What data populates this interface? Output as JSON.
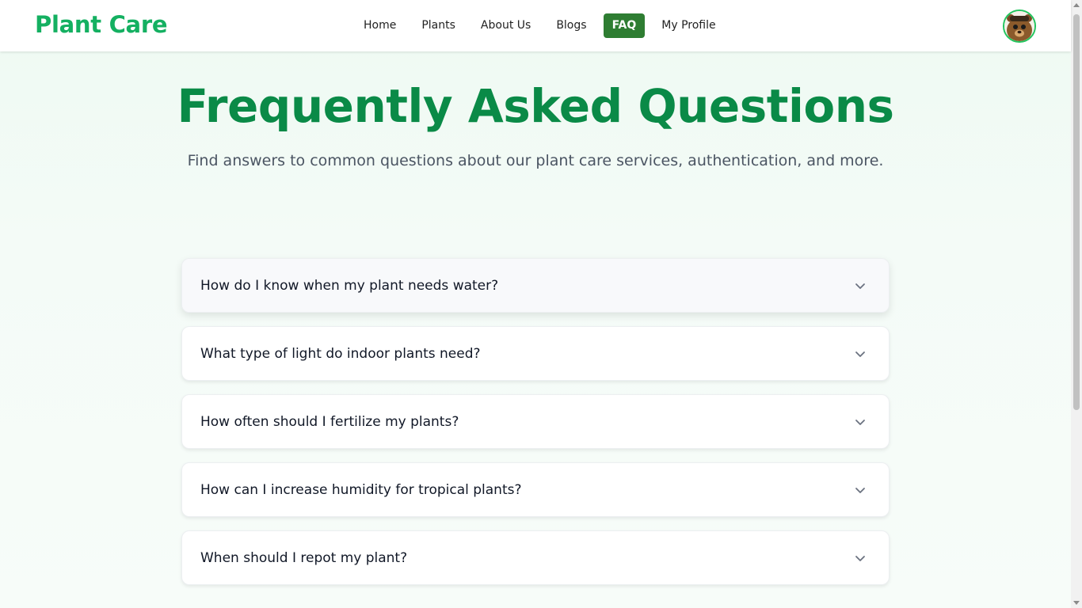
{
  "brand": {
    "name": "Plant Care",
    "color": "#14b061"
  },
  "nav": {
    "links": [
      {
        "label": "Home"
      },
      {
        "label": "Plants"
      },
      {
        "label": "About Us"
      },
      {
        "label": "Blogs"
      },
      {
        "label": "FAQ",
        "active": true
      },
      {
        "label": "My Profile"
      }
    ],
    "active_color": "#2e7d32"
  },
  "user": {
    "avatar_icon": "bear-avatar-icon"
  },
  "hero": {
    "title": "Frequently Asked Questions",
    "subtitle": "Find answers to common questions about our plant care services, authentication, and more.",
    "title_color": "#0a8a47"
  },
  "faq": {
    "items": [
      {
        "question": "How do I know when my plant needs water?",
        "icon": "chevron-down-icon"
      },
      {
        "question": "What type of light do indoor plants need?",
        "icon": "chevron-down-icon"
      },
      {
        "question": "How often should I fertilize my plants?",
        "icon": "chevron-down-icon"
      },
      {
        "question": "How can I increase humidity for tropical plants?",
        "icon": "chevron-down-icon"
      },
      {
        "question": "When should I repot my plant?",
        "icon": "chevron-down-icon"
      }
    ]
  }
}
